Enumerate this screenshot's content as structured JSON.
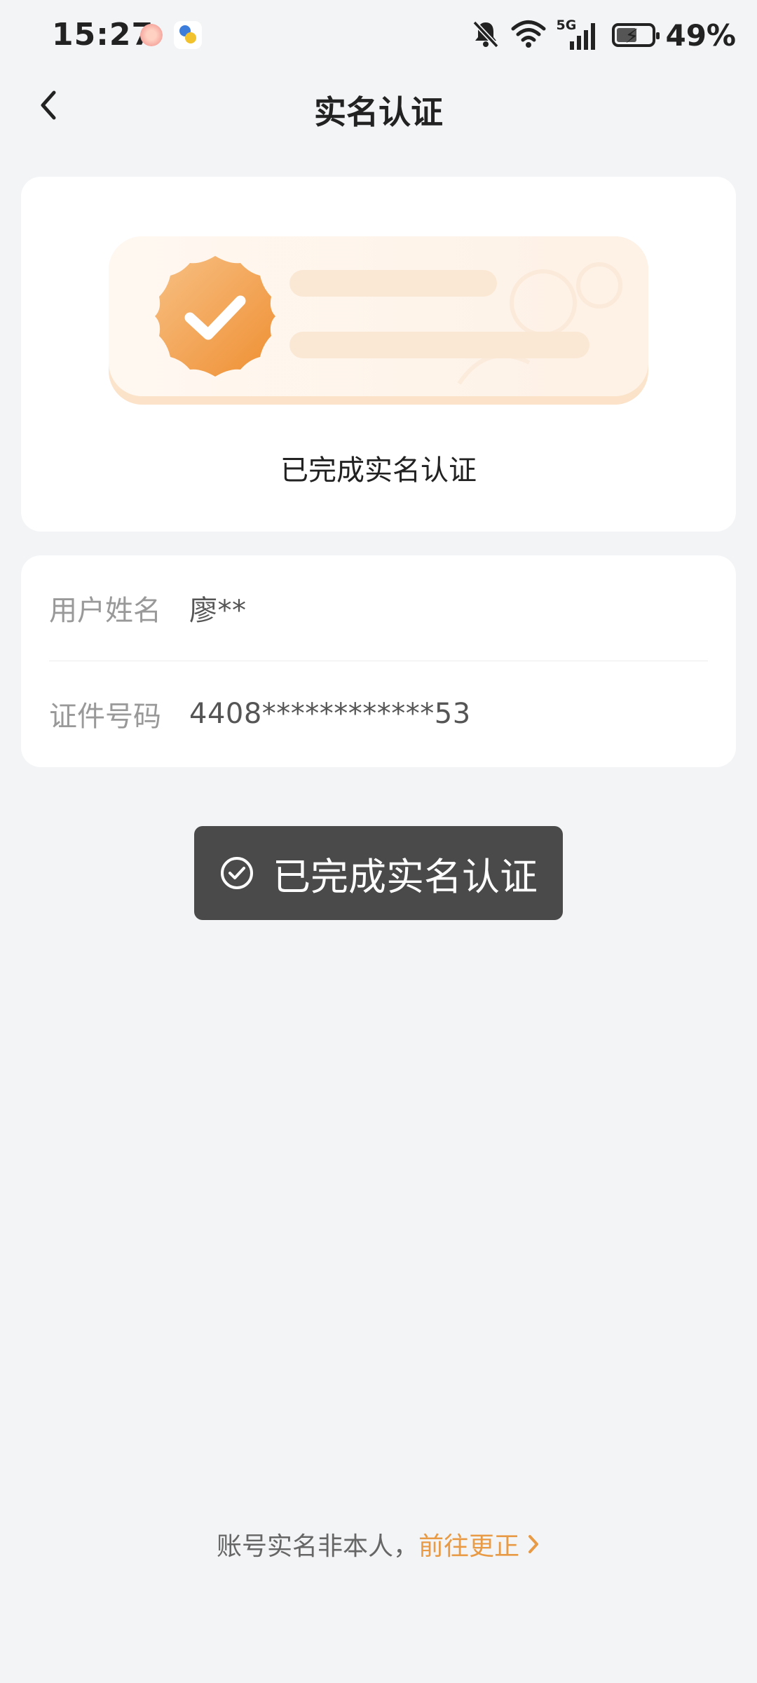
{
  "status_bar": {
    "time": "15:27",
    "network": "5G",
    "battery_percent": "49%",
    "icons": [
      "app-flower-icon",
      "app-pinwheel-icon",
      "bell-muted-icon",
      "wifi-icon",
      "signal-5g-icon",
      "battery-charging-icon"
    ]
  },
  "nav": {
    "title": "实名认证",
    "back_icon": "chevron-left-icon"
  },
  "verification": {
    "status_text": "已完成实名认证",
    "badge_icon": "verified-seal-icon"
  },
  "info": {
    "rows": [
      {
        "label": "用户姓名",
        "value": "廖**"
      },
      {
        "label": "证件号码",
        "value": "4408************53"
      }
    ]
  },
  "toast": {
    "icon": "check-circle-icon",
    "text": "已完成实名认证"
  },
  "footer": {
    "prompt": "账号实名非本人，",
    "link_text": "前往更正",
    "link_icon": "chevron-right-icon"
  },
  "colors": {
    "background": "#f3f4f6",
    "accent": "#e89a45",
    "toast_bg": "#4a4a4a",
    "seal_gradient_start": "#f7c084",
    "seal_gradient_end": "#ef8f32"
  }
}
